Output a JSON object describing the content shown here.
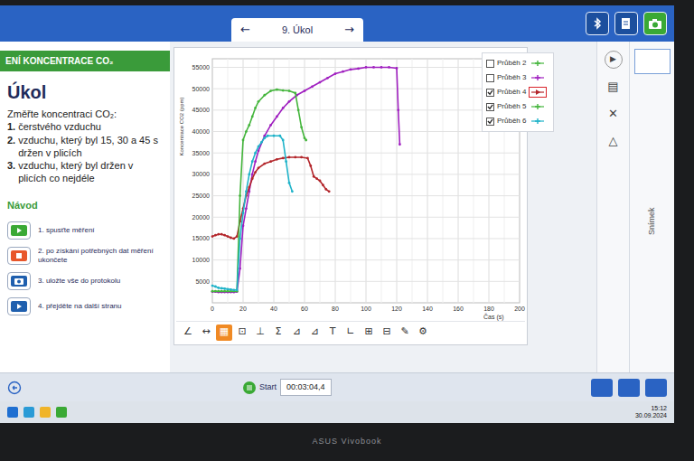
{
  "topbar": {
    "prev": "←",
    "tab": "9. Úkol",
    "next": "→"
  },
  "task": {
    "header": "ENÍ KONCENTRACE CO₂",
    "title": "Úkol",
    "intro": "Změřte koncentraci CO₂:",
    "items": [
      {
        "num": "1.",
        "text": "čerstvého vzduchu"
      },
      {
        "num": "2.",
        "text": "vzduchu, který byl 15, 30 a 45 s držen v plicích"
      },
      {
        "num": "3.",
        "text": "vzduchu, který byl držen v plicích co nejdéle"
      }
    ]
  },
  "guide": {
    "title": "Návod",
    "steps": [
      {
        "kind": "play",
        "text": "1. spusťte měření"
      },
      {
        "kind": "stop",
        "text": "2. po získání potřebných dat měření ukončete"
      },
      {
        "kind": "camera",
        "text": "3. uložte vše do protokolu"
      },
      {
        "kind": "next",
        "text": "4. přejděte na další stranu"
      }
    ]
  },
  "chart": {
    "y_label": "Koncentrace CO2 (ppm)",
    "y_ticks": [
      "55000",
      "50000",
      "45000",
      "40000",
      "35000",
      "30000",
      "25000",
      "20000",
      "15000",
      "10000",
      "5000"
    ],
    "x_ticks": [
      "0",
      "20",
      "40",
      "60",
      "80",
      "100",
      "120",
      "140",
      "160",
      "180",
      "200"
    ],
    "x_label": "Čas (s)",
    "series": [
      {
        "name": "Průběh 2",
        "checked": false,
        "selected": false,
        "color": "#44b53c",
        "x": [],
        "y": []
      },
      {
        "name": "Průběh 3",
        "checked": false,
        "selected": false,
        "color": "#a020c0",
        "x": [
          0,
          2,
          4,
          6,
          8,
          10,
          12,
          14,
          16,
          18,
          20,
          22,
          24,
          26,
          28,
          30,
          34,
          38,
          42,
          46,
          50,
          55,
          60,
          65,
          70,
          75,
          80,
          85,
          90,
          95,
          100,
          105,
          110,
          115,
          120,
          121,
          122
        ],
        "y": [
          2600,
          2600,
          2500,
          2500,
          2500,
          2500,
          2500,
          2500,
          2600,
          8000,
          18000,
          22000,
          26000,
          30000,
          33000,
          35500,
          39000,
          41500,
          43500,
          45500,
          47000,
          48500,
          49500,
          50500,
          51500,
          52500,
          53500,
          54000,
          54500,
          54700,
          55000,
          55000,
          55000,
          55000,
          54800,
          45000,
          37000
        ]
      },
      {
        "name": "Průběh 4",
        "checked": true,
        "selected": true,
        "color": "#b3262b",
        "x": [
          0,
          2,
          4,
          6,
          8,
          10,
          12,
          14,
          16,
          18,
          20,
          22,
          24,
          26,
          28,
          30,
          34,
          38,
          42,
          46,
          50,
          54,
          58,
          62,
          64,
          66,
          68,
          70,
          72,
          74,
          76
        ],
        "y": [
          15500,
          15800,
          16000,
          16000,
          15800,
          15500,
          15200,
          15000,
          15500,
          19000,
          22000,
          25000,
          27000,
          29000,
          30500,
          31500,
          32500,
          33000,
          33500,
          33800,
          34000,
          34000,
          34000,
          33800,
          32000,
          29500,
          29000,
          28500,
          27500,
          26500,
          26000
        ]
      },
      {
        "name": "Průběh 5",
        "checked": true,
        "selected": false,
        "color": "#44b53c",
        "x": [
          0,
          2,
          4,
          6,
          8,
          10,
          12,
          14,
          16,
          18,
          20,
          22,
          24,
          26,
          28,
          30,
          34,
          38,
          42,
          46,
          50,
          54,
          56,
          58,
          60,
          61
        ],
        "y": [
          2700,
          2700,
          2700,
          2700,
          2700,
          2700,
          2700,
          2700,
          2700,
          25000,
          38000,
          40000,
          41500,
          43500,
          45500,
          47000,
          48500,
          49500,
          49800,
          49600,
          49500,
          49000,
          45000,
          41000,
          38500,
          38000
        ]
      },
      {
        "name": "Průběh 6",
        "checked": true,
        "selected": false,
        "color": "#1fb3c9",
        "x": [
          0,
          2,
          4,
          6,
          8,
          10,
          12,
          14,
          16,
          18,
          20,
          22,
          24,
          26,
          28,
          30,
          32,
          34,
          36,
          40,
          44,
          46,
          48,
          50,
          52
        ],
        "y": [
          4000,
          3800,
          3500,
          3400,
          3300,
          3200,
          3100,
          3000,
          3000,
          15000,
          21000,
          26000,
          30000,
          33000,
          35000,
          36500,
          37500,
          38500,
          39000,
          39000,
          39000,
          38000,
          33000,
          28000,
          26000
        ]
      }
    ]
  },
  "toolbar": [
    {
      "glyph": "∠",
      "selected": false
    },
    {
      "glyph": "↔",
      "selected": false
    },
    {
      "glyph": "▦",
      "selected": true
    },
    {
      "glyph": "⊡",
      "selected": false
    },
    {
      "glyph": "⊥",
      "selected": false
    },
    {
      "glyph": "Σ",
      "selected": false
    },
    {
      "glyph": "⊿",
      "selected": false
    },
    {
      "glyph": "⊿",
      "selected": false
    },
    {
      "glyph": "T",
      "selected": false
    },
    {
      "glyph": "∟",
      "selected": false
    },
    {
      "glyph": "⊞",
      "selected": false
    },
    {
      "glyph": "⊟",
      "selected": false
    },
    {
      "glyph": "✎",
      "selected": false
    },
    {
      "glyph": "⚙",
      "selected": false
    }
  ],
  "rail": [
    "▶",
    "▤",
    "✕",
    "△"
  ],
  "thumbnail_label": "Snímek",
  "appbar": {
    "start": "Start",
    "elapsed": "00:03:04,4"
  },
  "taskbar": {
    "time": "15:12",
    "date": "30.09.2024"
  },
  "device": "ASUS Vivobook"
}
